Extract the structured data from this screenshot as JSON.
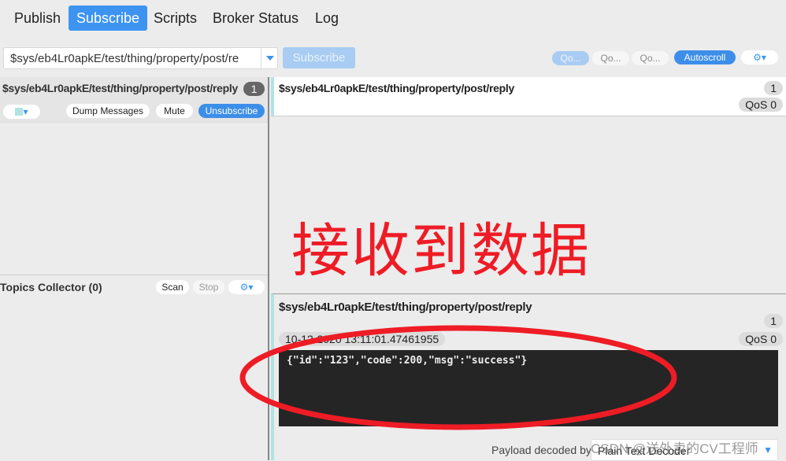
{
  "tabs": [
    {
      "label": "Publish"
    },
    {
      "label": "Subscribe"
    },
    {
      "label": "Scripts"
    },
    {
      "label": "Broker Status"
    },
    {
      "label": "Log"
    }
  ],
  "toolbar": {
    "topic_value": "$sys/eb4Lr0apkE/test/thing/property/post/re",
    "subscribe_label": "Subscribe",
    "qos": [
      "Qo...",
      "Qo...",
      "Qo..."
    ],
    "autoscroll_label": "Autoscroll"
  },
  "subscription": {
    "topic": "$sys/eb4Lr0apkE/test/thing/property/post/reply",
    "count": "1",
    "dump_label": "Dump Messages",
    "mute_label": "Mute",
    "unsubscribe_label": "Unsubscribe",
    "color": "#b2e3e3"
  },
  "topics_collector": {
    "title": "Topics Collector (0)",
    "scan_label": "Scan",
    "stop_label": "Stop"
  },
  "message_list": [
    {
      "topic": "$sys/eb4Lr0apkE/test/thing/property/post/reply",
      "count": "1",
      "qos": "QoS 0"
    }
  ],
  "detail": {
    "topic": "$sys/eb4Lr0apkE/test/thing/property/post/reply",
    "count": "1",
    "timestamp": "10-12-2020 13:11:01.47461955",
    "qos": "QoS 0",
    "payload": "{\"id\":\"123\",\"code\":200,\"msg\":\"success\"}",
    "decoded_by_label": "Payload decoded by",
    "decoder": "Plain Text Decoder"
  },
  "annotation": {
    "text": "接收到数据",
    "color": "#ee1c25"
  },
  "watermark": "CSDN @送外卖的CV工程师"
}
